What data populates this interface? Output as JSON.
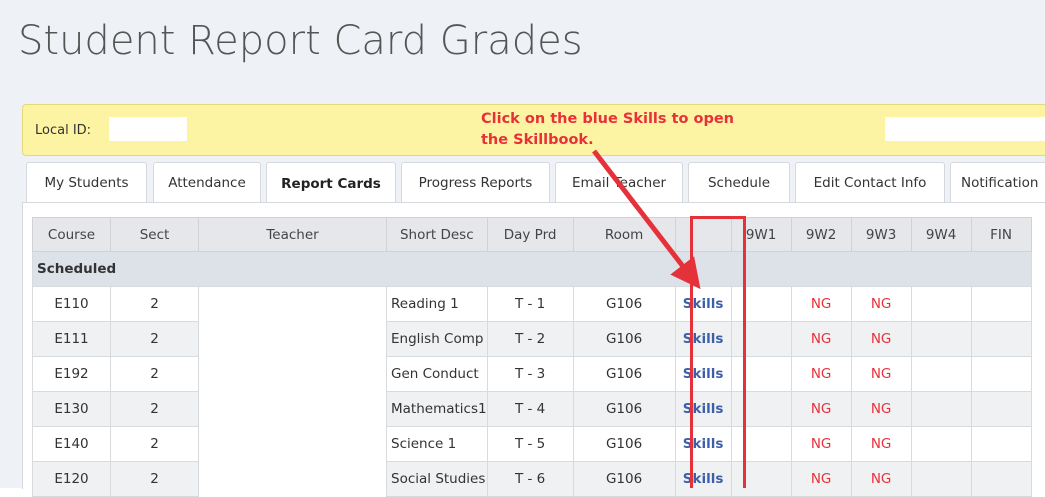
{
  "page": {
    "title": "Student Report Card Grades"
  },
  "idbar": {
    "label": "Local ID:"
  },
  "annotation": {
    "line1": "Click on the blue Skills to open",
    "line2": "the Skillbook.",
    "color": "#e8303a"
  },
  "tabs": [
    {
      "label": "My Students"
    },
    {
      "label": "Attendance"
    },
    {
      "label": "Report Cards",
      "active": true
    },
    {
      "label": "Progress Reports"
    },
    {
      "label": "Email Teacher"
    },
    {
      "label": "Schedule"
    },
    {
      "label": "Edit Contact Info"
    },
    {
      "label": "Notification"
    }
  ],
  "table": {
    "headers": [
      "Course",
      "Sect",
      "Teacher",
      "Short Desc",
      "Day Prd",
      "Room",
      "",
      "9W1",
      "9W2",
      "9W3",
      "9W4",
      "FIN"
    ],
    "group_label": "Scheduled",
    "rows": [
      {
        "course": "E110",
        "sect": "2",
        "teacher": "",
        "desc": "Reading 1",
        "dayprd": "T - 1",
        "room": "G106",
        "skills": "Skills",
        "w1": "",
        "w2": "NG",
        "w3": "NG",
        "w4": "",
        "fin": ""
      },
      {
        "course": "E111",
        "sect": "2",
        "teacher": "",
        "desc": "English Comp",
        "dayprd": "T - 2",
        "room": "G106",
        "skills": "Skills",
        "w1": "",
        "w2": "NG",
        "w3": "NG",
        "w4": "",
        "fin": ""
      },
      {
        "course": "E192",
        "sect": "2",
        "teacher": "",
        "desc": "Gen Conduct",
        "dayprd": "T - 3",
        "room": "G106",
        "skills": "Skills",
        "w1": "",
        "w2": "NG",
        "w3": "NG",
        "w4": "",
        "fin": ""
      },
      {
        "course": "E130",
        "sect": "2",
        "teacher": "",
        "desc": "Mathematics1",
        "dayprd": "T - 4",
        "room": "G106",
        "skills": "Skills",
        "w1": "",
        "w2": "NG",
        "w3": "NG",
        "w4": "",
        "fin": ""
      },
      {
        "course": "E140",
        "sect": "2",
        "teacher": "",
        "desc": "Science 1",
        "dayprd": "T - 5",
        "room": "G106",
        "skills": "Skills",
        "w1": "",
        "w2": "NG",
        "w3": "NG",
        "w4": "",
        "fin": ""
      },
      {
        "course": "E120",
        "sect": "2",
        "teacher": "",
        "desc": "Social Studies",
        "dayprd": "T - 6",
        "room": "G106",
        "skills": "Skills",
        "w1": "",
        "w2": "NG",
        "w3": "NG",
        "w4": "",
        "fin": ""
      }
    ]
  },
  "colors": {
    "skills_link": "#3d5fa8",
    "ng": "#e8303a",
    "highlight_box": "#e5313a",
    "idbar_bg": "#fdf4a3"
  }
}
